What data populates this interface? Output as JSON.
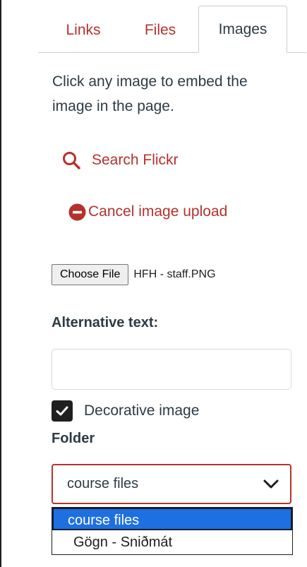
{
  "tabs": [
    {
      "label": "Links",
      "active": false
    },
    {
      "label": "Files",
      "active": false
    },
    {
      "label": "Images",
      "active": true
    }
  ],
  "intro_text": "Click any image to embed the image in the page.",
  "search_flickr": {
    "label": "Search Flickr",
    "icon": "search-icon"
  },
  "cancel_upload": {
    "label": "Cancel image upload",
    "icon": "minus-circle-icon"
  },
  "file_input": {
    "button_label": "Choose File",
    "file_name": "HFH - staff.PNG"
  },
  "alt_text": {
    "label": "Alternative text:",
    "value": ""
  },
  "decorative": {
    "label": "Decorative image",
    "checked": true
  },
  "folder": {
    "label": "Folder",
    "selected": "course files",
    "options": [
      "course files",
      "Gögn - Sniðmát"
    ]
  },
  "colors": {
    "accent": "#b5312c",
    "text": "#2d3b45",
    "option_highlight": "#1e6fe0"
  }
}
